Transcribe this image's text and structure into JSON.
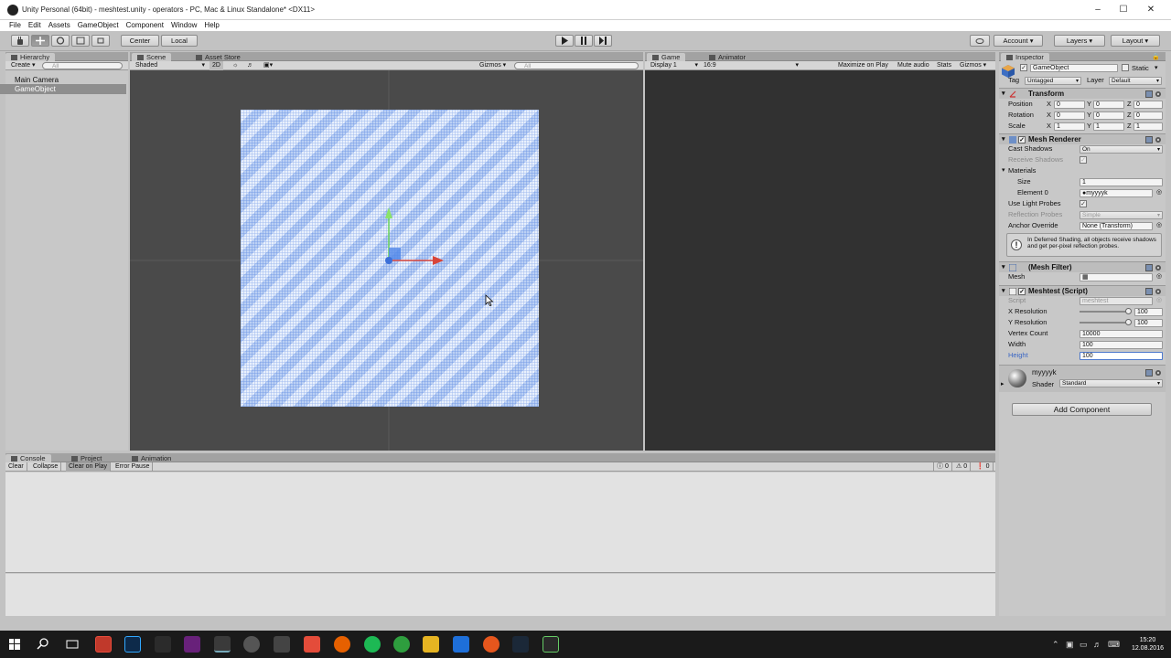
{
  "window": {
    "title": "Unity Personal (64bit) - meshtest.unity - operators - PC, Mac & Linux Standalone* <DX11>"
  },
  "menu": [
    "File",
    "Edit",
    "Assets",
    "GameObject",
    "Component",
    "Window",
    "Help"
  ],
  "toolbar": {
    "center_label": "Center",
    "local_label": "Local",
    "account_label": "Account",
    "layers_label": "Layers",
    "layout_label": "Layout"
  },
  "hierarchy": {
    "tab": "Hierarchy",
    "create_label": "Create",
    "search_placeholder": "All",
    "items": [
      "Main Camera",
      "GameObject"
    ]
  },
  "scene": {
    "tab": "Scene",
    "tab2": "Asset Store",
    "shading": "Shaded",
    "mode_2d": "2D",
    "gizmos": "Gizmos",
    "search_placeholder": "All"
  },
  "game": {
    "tab": "Game",
    "tab2": "Animator",
    "display": "Display 1",
    "aspect": "16:9",
    "maximize": "Maximize on Play",
    "mute": "Mute audio",
    "stats": "Stats",
    "gizmos": "Gizmos"
  },
  "inspector": {
    "tab": "Inspector",
    "object_name": "GameObject",
    "static_label": "Static",
    "tag_label": "Tag",
    "tag_value": "Untagged",
    "layer_label": "Layer",
    "layer_value": "Default",
    "transform": {
      "title": "Transform",
      "rows": [
        {
          "label": "Position",
          "x": "0",
          "y": "0",
          "z": "0"
        },
        {
          "label": "Rotation",
          "x": "0",
          "y": "0",
          "z": "0"
        },
        {
          "label": "Scale",
          "x": "1",
          "y": "1",
          "z": "1"
        }
      ]
    },
    "mesh_renderer": {
      "title": "Mesh Renderer",
      "cast_shadows_label": "Cast Shadows",
      "cast_shadows_value": "On",
      "receive_shadows_label": "Receive Shadows",
      "materials_label": "Materials",
      "size_label": "Size",
      "size_value": "1",
      "element0_label": "Element 0",
      "element0_value": "myyyyk",
      "light_probes_label": "Use Light Probes",
      "reflection_label": "Reflection Probes",
      "reflection_value": "Simple",
      "anchor_label": "Anchor Override",
      "anchor_value": "None (Transform)",
      "help": "In Deferred Shading, all objects receive shadows and get per-pixel reflection probes."
    },
    "mesh_filter": {
      "title": "(Mesh Filter)",
      "mesh_label": "Mesh",
      "mesh_value": ""
    },
    "script": {
      "title": "Meshtest (Script)",
      "script_label": "Script",
      "script_value": "meshtest",
      "x_res_label": "X Resolution",
      "x_res_value": "100",
      "y_res_label": "Y Resolution",
      "y_res_value": "100",
      "vertex_label": "Vertex Count",
      "vertex_value": "10000",
      "width_label": "Width",
      "width_value": "100",
      "height_label": "Height",
      "height_value": "100"
    },
    "material": {
      "name": "myyyyk",
      "shader_label": "Shader",
      "shader_value": "Standard"
    },
    "add_component": "Add Component"
  },
  "console": {
    "tab": "Console",
    "tab2": "Project",
    "tab3": "Animation",
    "buttons": [
      "Clear",
      "Collapse",
      "Clear on Play",
      "Error Pause"
    ],
    "counts": [
      "0",
      "0",
      "0"
    ]
  },
  "clock": {
    "time": "15:20",
    "date": "12.08.2016"
  }
}
